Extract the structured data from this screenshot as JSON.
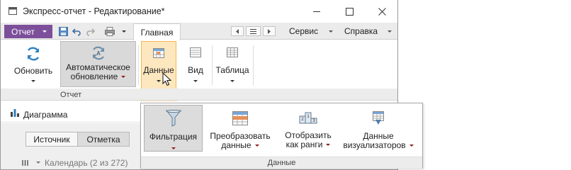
{
  "window": {
    "title": "Экспресс-отчет - Редактирование*"
  },
  "tabbar": {
    "report_button": "Отчет",
    "active_tab": "Главная",
    "menus": [
      "Сервис",
      "Справка"
    ]
  },
  "ribbon": {
    "buttons": {
      "refresh": "Обновить",
      "auto_refresh_line1": "Автоматическое",
      "auto_refresh_line2": "обновление",
      "data": "Данные",
      "view": "Вид",
      "table": "Таблица"
    },
    "group_label": "Отчет"
  },
  "panel": {
    "title": "Диаграмма",
    "segments": [
      "Источник",
      "Отметка"
    ],
    "list_item": "Календарь (2 из 272)"
  },
  "popup": {
    "buttons": {
      "filter": "Фильтрация",
      "transform_line1": "Преобразовать",
      "transform_line2": "данные",
      "ranks_line1": "Отобразить",
      "ranks_line2": "как ранги",
      "visualizers_line1": "Данные",
      "visualizers_line2": "визуализаторов"
    },
    "group_label": "Данные"
  },
  "colors": {
    "accent_purple": "#7d4f9b",
    "highlight_orange": "#f3b74f",
    "highlight_fill": "#fde7bf",
    "refresh_blue": "#2e7fbf"
  }
}
